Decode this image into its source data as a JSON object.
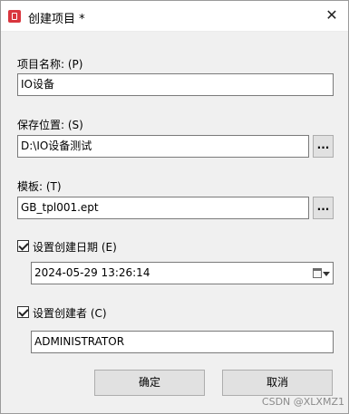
{
  "window": {
    "title": "创建项目 *",
    "close_glyph": "✕"
  },
  "project_name": {
    "label": "项目名称: (P)",
    "value": "IO设备"
  },
  "save_location": {
    "label": "保存位置: (S)",
    "value": "D:\\IO设备测试",
    "browse_label": "..."
  },
  "template": {
    "label": "模板: (T)",
    "value": "GB_tpl001.ept",
    "browse_label": "..."
  },
  "creation_date": {
    "checked": true,
    "label": "设置创建日期 (E)",
    "value": "2024-05-29 13:26:14"
  },
  "creator": {
    "checked": true,
    "label": "设置创建者 (C)",
    "value": "ADMINISTRATOR"
  },
  "buttons": {
    "ok": "确定",
    "cancel": "取消"
  },
  "watermark": "CSDN @XLXMZ1",
  "icons": {
    "app": "app-logo-icon",
    "close": "close-icon",
    "calendar": "calendar-icon",
    "dropdown": "chevron-down-icon"
  },
  "colors": {
    "app_icon": "#d9363e",
    "background": "#f0f0f0",
    "button": "#e1e1e1"
  }
}
